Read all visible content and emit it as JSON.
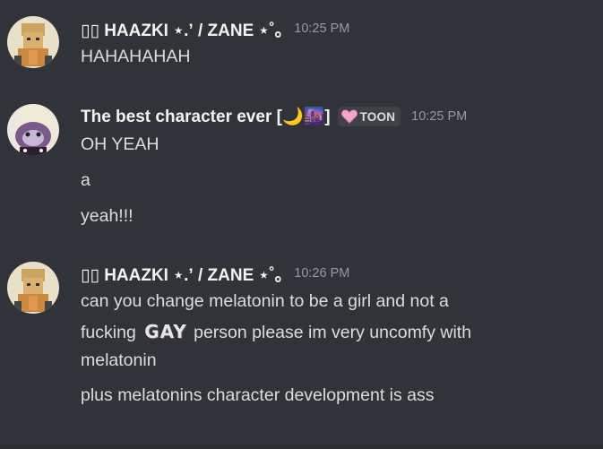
{
  "messages": [
    {
      "username": "▯▯ HAAZKI ⋆.ʼ / ZANE ⋆˚｡",
      "timestamp": "10:25 PM",
      "lines": [
        "HAHAHAHAH"
      ]
    },
    {
      "username": "The best character ever [🌙🌆]",
      "tag": "TOON",
      "timestamp": "10:25 PM",
      "lines": [
        "OH YEAH",
        "a",
        "yeah!!!"
      ]
    },
    {
      "username": "▯▯ HAAZKI ⋆.ʼ / ZANE ⋆˚｡",
      "timestamp": "10:26 PM",
      "line1": "can you change melatonin to be a girl and not a",
      "line2_before": "fucking",
      "line2_emoji": "GAY",
      "line2_after": "person please im very uncomfy with",
      "line3": "melatonin",
      "line4": "plus melatonins character development is ass"
    }
  ],
  "colors": {
    "background": "#313338",
    "text": "#dbdee1",
    "username": "#f2f3f5",
    "timestamp": "#949ba4"
  },
  "icons": [
    "avatar-haazki",
    "avatar-toon",
    "heart-icon"
  ]
}
